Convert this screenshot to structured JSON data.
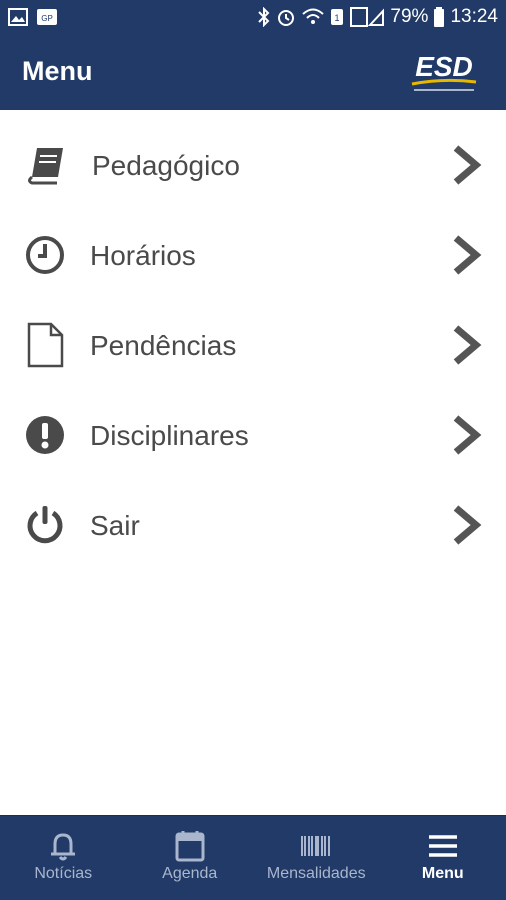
{
  "status_bar": {
    "battery_percent": "79%",
    "time": "13:24"
  },
  "app_bar": {
    "title": "Menu",
    "logo_text": "ESD"
  },
  "menu": {
    "items": [
      {
        "label": "Pedagógico",
        "icon": "book-icon"
      },
      {
        "label": "Horários",
        "icon": "clock-icon"
      },
      {
        "label": "Pendências",
        "icon": "document-icon"
      },
      {
        "label": "Disciplinares",
        "icon": "exclamation-icon"
      },
      {
        "label": "Sair",
        "icon": "power-icon"
      }
    ]
  },
  "bottom_nav": {
    "items": [
      {
        "label": "Notícias",
        "icon": "bell-icon",
        "active": false
      },
      {
        "label": "Agenda",
        "icon": "calendar-icon",
        "active": false
      },
      {
        "label": "Mensalidades",
        "icon": "barcode-icon",
        "active": false
      },
      {
        "label": "Menu",
        "icon": "hamburger-icon",
        "active": true
      }
    ]
  },
  "colors": {
    "primary": "#213a68",
    "icon_gray": "#4a4a4a",
    "chevron_gray": "#555555",
    "logo_accent": "#e6b800"
  }
}
